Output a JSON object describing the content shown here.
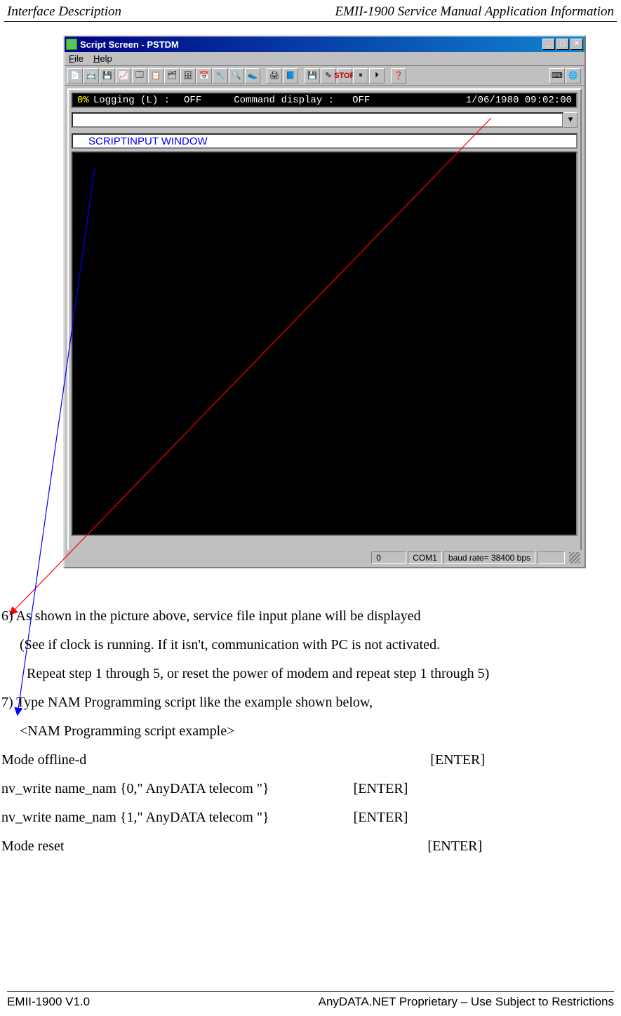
{
  "page_header": {
    "left": "Interface Description",
    "right": "EMII-1900 Service Manual Application Information"
  },
  "page_footer": {
    "left": "EMII-1900 V1.0",
    "right": "AnyDATA.NET Proprietary – Use Subject to Restrictions"
  },
  "window": {
    "title": "Script Screen - PSTDM",
    "menus": {
      "file": "File",
      "help": "Help"
    },
    "win_buttons": {
      "min": "_",
      "max": "□",
      "close": "×"
    },
    "status_strip": {
      "percent": "0%",
      "logging_label": "Logging (L) :",
      "logging_value": "OFF",
      "cmd_label": "Command display :",
      "cmd_value": "OFF",
      "datetime": "1/06/1980 09:02:00"
    },
    "script_label": "SCRIPTINPUT WINDOW",
    "combo_arrow": "▾",
    "statusbar": {
      "pane1": "0",
      "pane2": "COM1",
      "pane3": "baud rate= 38400 bps",
      "pane4": ""
    },
    "toolbar_icons": {
      "b1": "📄",
      "b2": "📇",
      "b3": "💾",
      "b4": "📈",
      "b5": "🗔",
      "b6": "📋",
      "b7": "🗂",
      "b8": "🗄",
      "b9": "📅",
      "b10": "🔧",
      "b11": "🔍",
      "b12": "👟",
      "b13": "🖨",
      "b14": "📘",
      "b15": "💾",
      "b16": "✎",
      "b17": "STOP",
      "b18": "⏸",
      "b19": "⏵",
      "b20": "❓",
      "b21": "⌨",
      "b22": "🌐"
    }
  },
  "body": {
    "l6": "6) As shown in the picture above, service file input plane will be displayed",
    "l6a": "(See if clock is running.   If it isn't, communication with PC is not activated.",
    "l6b": "Repeat step 1 through 5, or reset the power of modem and repeat step 1 through 5)",
    "l7": "7) Type NAM Programming script like the example shown below,",
    "l7a": "<NAM Programming script example>",
    "cmds": [
      {
        "c": "Mode offline-d",
        "e": "[ENTER]",
        "pad": 490
      },
      {
        "c": "nv_write name_nam {0,\" AnyDATA telecom \"}",
        "e": "[ENTER]",
        "pad": 120
      },
      {
        "c": "nv_write name_nam {1,\" AnyDATA telecom \"}",
        "e": "[ENTER]",
        "pad": 120
      },
      {
        "c": "Mode reset",
        "e": "[ENTER]",
        "pad": 518
      }
    ]
  }
}
